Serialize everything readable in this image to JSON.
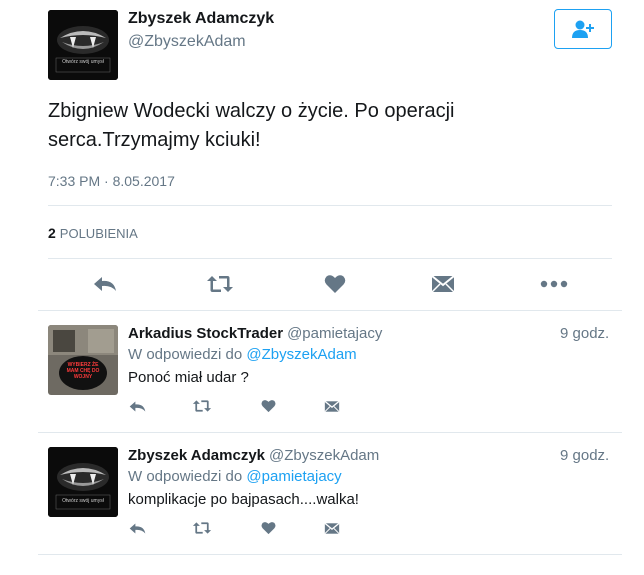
{
  "tweet": {
    "author_name": "Zbyszek Adamczyk",
    "author_handle": "@ZbyszekAdam",
    "avatar_caption": "Otwórz swój umysł",
    "text": "Zbigniew Wodecki walczy o życie. Po operacji serca.Trzymajmy kciuki!",
    "time": "7:33 PM · 8.05.2017",
    "likes_count": "2",
    "likes_label": "POLUBIENIA"
  },
  "replies": [
    {
      "author_name": "Arkadius StockTrader",
      "author_handle": "@pamietajacy",
      "time": "9 godz.",
      "reply_prefix": "W odpowiedzi do",
      "reply_to": "@ZbyszekAdam",
      "text": "Ponoć miał udar ?",
      "avatar_caption": "WYBIERZ ŻE MAM CHĘ DO WOJNY"
    },
    {
      "author_name": "Zbyszek Adamczyk",
      "author_handle": "@ZbyszekAdam",
      "time": "9 godz.",
      "reply_prefix": "W odpowiedzi do",
      "reply_to": "@pamietajacy",
      "text": "komplikacje po bajpasach....walka!",
      "avatar_caption": "Otwórz swój umysł"
    }
  ],
  "icons": {
    "follow": "follow-user-icon",
    "reply": "reply-icon",
    "retweet": "retweet-icon",
    "like": "heart-icon",
    "dm": "direct-message-icon",
    "more": "more-icon"
  },
  "colors": {
    "accent": "#1da1f2",
    "icon_gray": "#657786",
    "divider": "#e1e8ed"
  }
}
